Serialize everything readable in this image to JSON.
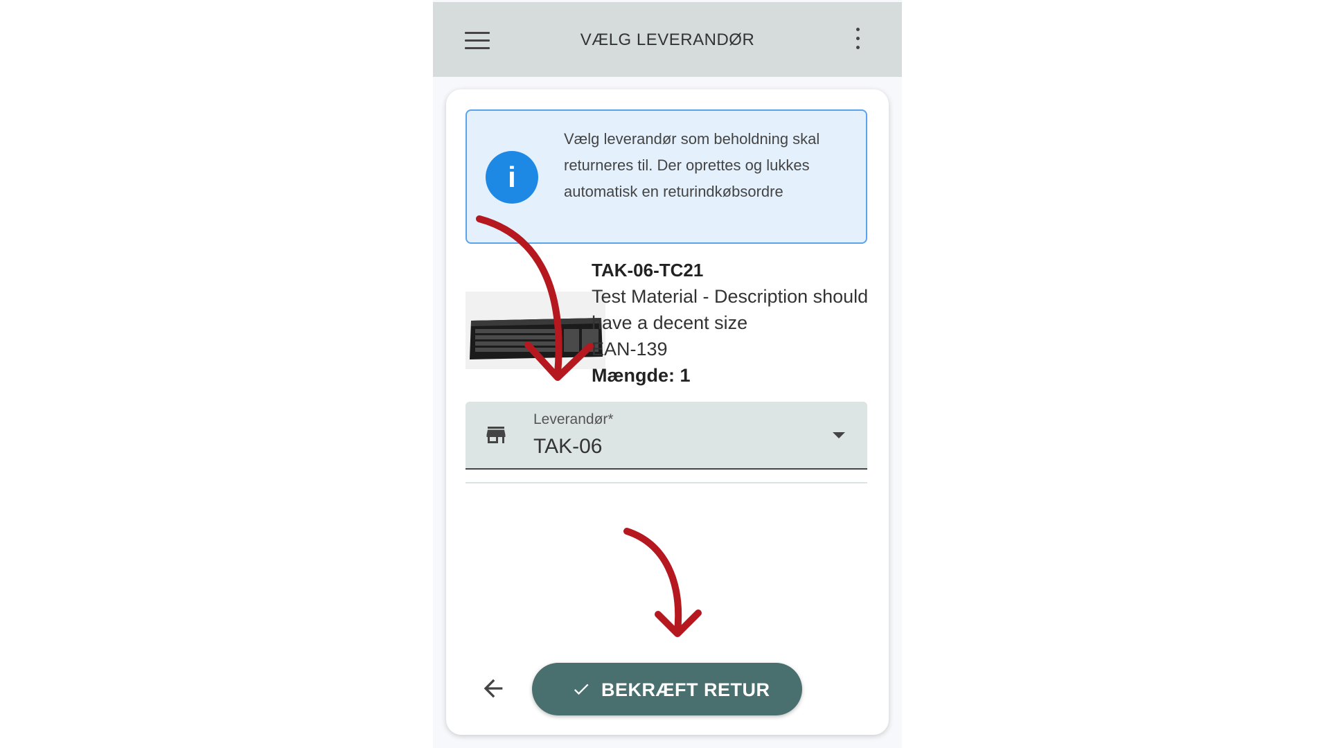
{
  "app_bar": {
    "title": "VÆLG LEVERANDØR",
    "menu_icon": "hamburger-menu-icon",
    "more_icon": "more-vert-icon"
  },
  "info": {
    "icon": "info-icon",
    "icon_glyph": "i",
    "text": "Vælg leverandør som beholdning skal returneres til. Der oprettes og lukkes automatisk en returindkøbsordre"
  },
  "product": {
    "image": "keyboard-image",
    "code": "TAK-06-TC21",
    "description": "Test Material - Description should have a decent size",
    "ean": "EAN-139",
    "quantity_label": "Mængde: 1"
  },
  "supplier_field": {
    "icon": "store-icon",
    "label": "Leverandør*",
    "value": "TAK-06"
  },
  "actions": {
    "back_icon": "arrow-back-icon",
    "confirm_icon": "check-icon",
    "confirm_label": "BEKRÆFT RETUR"
  },
  "colors": {
    "app_bar": "#d5dcdb",
    "info_bg": "#e4f1fd",
    "info_border": "#5aa3ea",
    "info_icon": "#1e88e5",
    "select_bg": "#dde4e4",
    "confirm_button": "#4a6f6f",
    "annotation_arrow": "#b5191f"
  }
}
